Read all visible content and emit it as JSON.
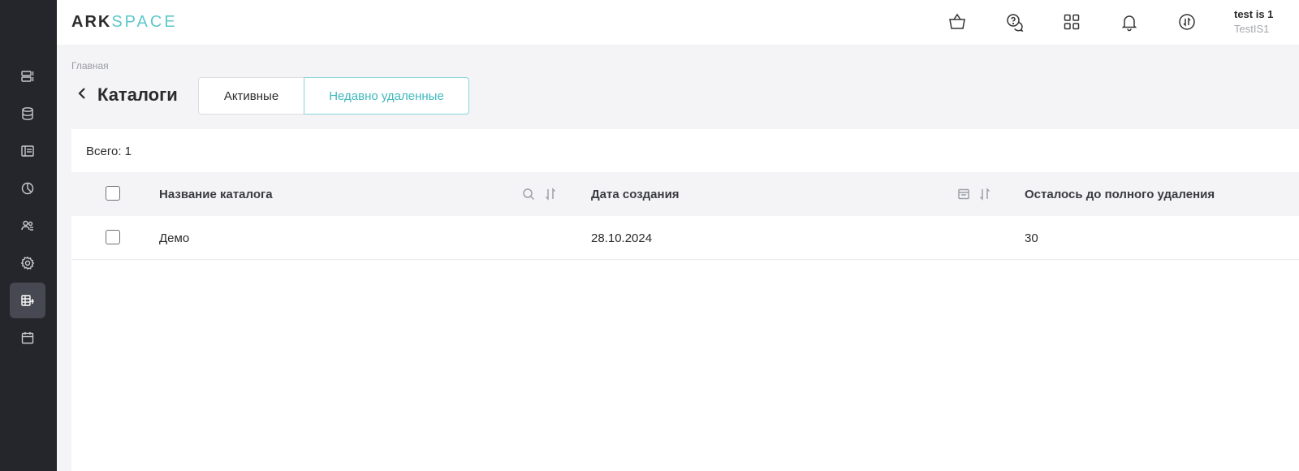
{
  "brand": {
    "part1": "ARK",
    "part2": "SPACE"
  },
  "sidebar": {
    "items": [
      {
        "icon": "server-icon",
        "active": false
      },
      {
        "icon": "database-icon",
        "active": false
      },
      {
        "icon": "layout-icon",
        "active": false
      },
      {
        "icon": "pie-chart-icon",
        "active": false
      },
      {
        "icon": "users-icon",
        "active": false
      },
      {
        "icon": "gear-icon",
        "active": false
      },
      {
        "icon": "catalog-icon",
        "active": true
      },
      {
        "icon": "calendar-icon",
        "active": false
      }
    ]
  },
  "header": {
    "icons": [
      "basket-icon",
      "help-chat-icon",
      "apps-grid-icon",
      "bell-icon",
      "sync-icon"
    ],
    "user_name": "test is 1",
    "user_org": "TestIS1"
  },
  "breadcrumb": "Главная",
  "page_title": "Каталоги",
  "tabs": [
    {
      "label": "Активные",
      "active": false
    },
    {
      "label": "Недавно удаленные",
      "active": true
    }
  ],
  "total_label": "Всего: 1",
  "table": {
    "columns": [
      "Название каталога",
      "Дата создания",
      "Осталось до полного удаления"
    ],
    "rows": [
      {
        "name": "Демо",
        "created": "28.10.2024",
        "remaining": "30"
      }
    ]
  },
  "colors": {
    "accent": "#3fb8bd",
    "sidebar_bg": "#25262b",
    "sidebar_active": "#474952"
  }
}
